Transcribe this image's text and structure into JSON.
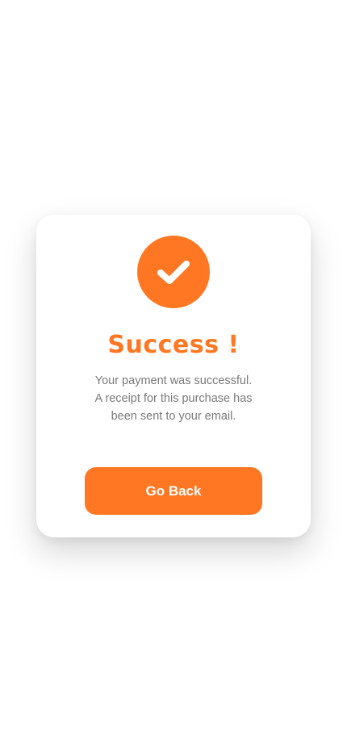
{
  "theme": {
    "accent": "#ff7722",
    "text_muted": "#7a7a7a",
    "card_bg": "#ffffff"
  },
  "dialog": {
    "icon": "check-circle-icon",
    "title": "Success !",
    "message_lines": [
      "Your payment was successful.",
      "A receipt for this purchase has",
      "been sent to your email."
    ],
    "button_label": "Go Back"
  }
}
